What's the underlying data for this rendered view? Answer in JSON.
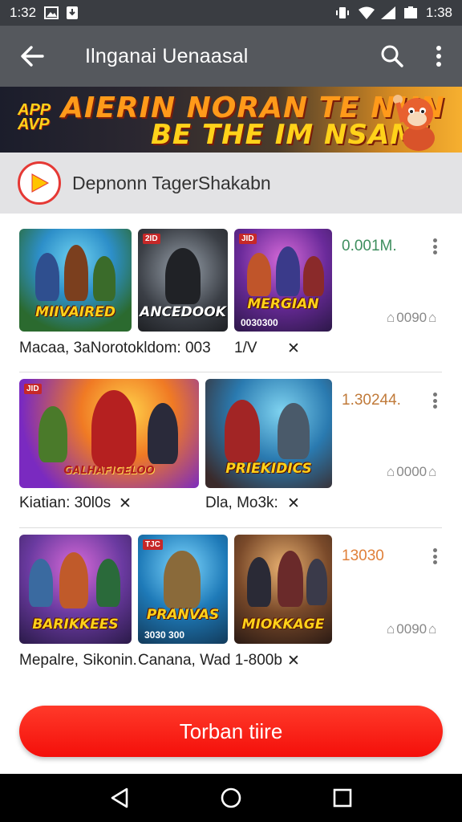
{
  "status": {
    "time_left": "1:32",
    "time_right": "1:38"
  },
  "appbar": {
    "title": "Ilnganai Uenaasal"
  },
  "banner": {
    "logo_line1": "APP",
    "logo_line2": "AVP",
    "headline1": "AIERIN NORAN TE NUN",
    "headline2": "BE THE IM NSAM!"
  },
  "channel": {
    "name": "Depnonn TagerShakabn"
  },
  "rows": [
    {
      "count": "0.001M.",
      "count_color": "#3e8e5e",
      "views": "0090",
      "caption_a": "Macaa, 3aNorotokldom:  003",
      "caption_b": "1/V",
      "thumbs": [
        {
          "title": "MIIVAIRED",
          "tag": ""
        },
        {
          "title": "ANCEDOOK",
          "tag": "2ID"
        },
        {
          "title": "MERGIAN",
          "tag": "JID",
          "sub": "0030300"
        }
      ]
    },
    {
      "count": "1.30244.",
      "count_color": "#c07a3a",
      "views": "0000",
      "caption_a": "Kiatian: 30l0s",
      "caption_b": "Dla, Mo3k:",
      "thumbs": [
        {
          "title": "GALHAFIGELOO",
          "tag": "JID"
        },
        {
          "title": "PRIEKIDICS",
          "tag": ""
        }
      ]
    },
    {
      "count": "13030",
      "count_color": "#e0803a",
      "views": "0090",
      "caption_a": "Mepalre, Sikonin.",
      "caption_b": "Canana, Wad  1-800b",
      "thumbs": [
        {
          "title": "BARIKKEES",
          "tag": ""
        },
        {
          "title": "PRANVAS",
          "tag": "TJC",
          "sub": "3030 300"
        },
        {
          "title": "MIOKKAGE",
          "tag": ""
        }
      ]
    }
  ],
  "cta": {
    "label": "Torban tiire"
  },
  "colors": {
    "statusbar": "#3a3d42",
    "appbar": "#55585d",
    "accent": "#f40f0a"
  }
}
